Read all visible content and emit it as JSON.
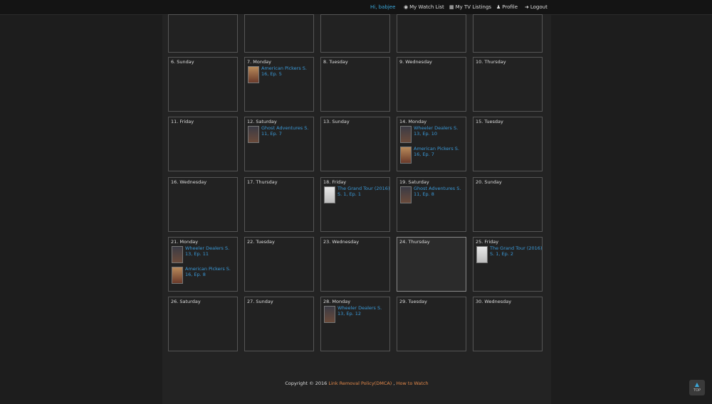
{
  "navbar": {
    "user_greeting": "Hi, babjee",
    "watch_list": "My Watch List",
    "tv_listings": "My TV Listings",
    "profile": "Profile",
    "logout": "Logout",
    "watch_icon": "eye-icon",
    "calendar_icon": "calendar-icon",
    "profile_icon": "user-icon",
    "logout_icon": "logout-icon"
  },
  "calendar": {
    "days": [
      {
        "label": "6. Sunday",
        "episodes": []
      },
      {
        "label": "7. Monday",
        "episodes": [
          {
            "title": "American Pickers S. 16, Ep. 5",
            "poster": "warm"
          }
        ]
      },
      {
        "label": "8. Tuesday",
        "episodes": []
      },
      {
        "label": "9. Wednesday",
        "episodes": []
      },
      {
        "label": "10. Thursday",
        "episodes": []
      },
      {
        "label": "11. Friday",
        "episodes": []
      },
      {
        "label": "12. Saturday",
        "episodes": [
          {
            "title": "Ghost Adventures S. 11, Ep. 7",
            "poster": "dark"
          }
        ]
      },
      {
        "label": "13. Sunday",
        "episodes": []
      },
      {
        "label": "14. Monday",
        "episodes": [
          {
            "title": "Wheeler Dealers S. 13, Ep. 10",
            "poster": "dark"
          },
          {
            "title": "American Pickers S. 16, Ep. 7",
            "poster": "warm"
          }
        ]
      },
      {
        "label": "15. Tuesday",
        "episodes": []
      },
      {
        "label": "16. Wednesday",
        "episodes": []
      },
      {
        "label": "17. Thursday",
        "episodes": []
      },
      {
        "label": "18. Friday",
        "episodes": [
          {
            "title": "The Grand Tour (2016) S. 1, Ep. 1",
            "poster": "light"
          }
        ]
      },
      {
        "label": "19. Saturday",
        "episodes": [
          {
            "title": "Ghost Adventures S. 11, Ep. 8",
            "poster": "dark"
          }
        ]
      },
      {
        "label": "20. Sunday",
        "episodes": []
      },
      {
        "label": "21. Monday",
        "episodes": [
          {
            "title": "Wheeler Dealers S. 13, Ep. 11",
            "poster": "dark"
          },
          {
            "title": "American Pickers S. 16, Ep. 8",
            "poster": "warm"
          }
        ]
      },
      {
        "label": "22. Tuesday",
        "episodes": []
      },
      {
        "label": "23. Wednesday",
        "episodes": []
      },
      {
        "label": "24. Thursday",
        "episodes": [],
        "today": true
      },
      {
        "label": "25. Friday",
        "episodes": [
          {
            "title": "The Grand Tour (2016) S. 1, Ep. 2",
            "poster": "light"
          }
        ]
      },
      {
        "label": "26. Saturday",
        "episodes": []
      },
      {
        "label": "27. Sunday",
        "episodes": []
      },
      {
        "label": "28. Monday",
        "episodes": [
          {
            "title": "Wheeler Dealers S. 13, Ep. 12",
            "poster": "dark"
          }
        ]
      },
      {
        "label": "29. Tuesday",
        "episodes": []
      },
      {
        "label": "30. Wednesday",
        "episodes": []
      }
    ]
  },
  "footer": {
    "copyright": "Copyright © 2016",
    "link_removal": "Link Removal Policy(DMCA)",
    "separator": ",",
    "how_to_watch": "How to Watch"
  },
  "top_button": {
    "arrow_icon": "chevron-up-icon",
    "label": "TOP"
  }
}
